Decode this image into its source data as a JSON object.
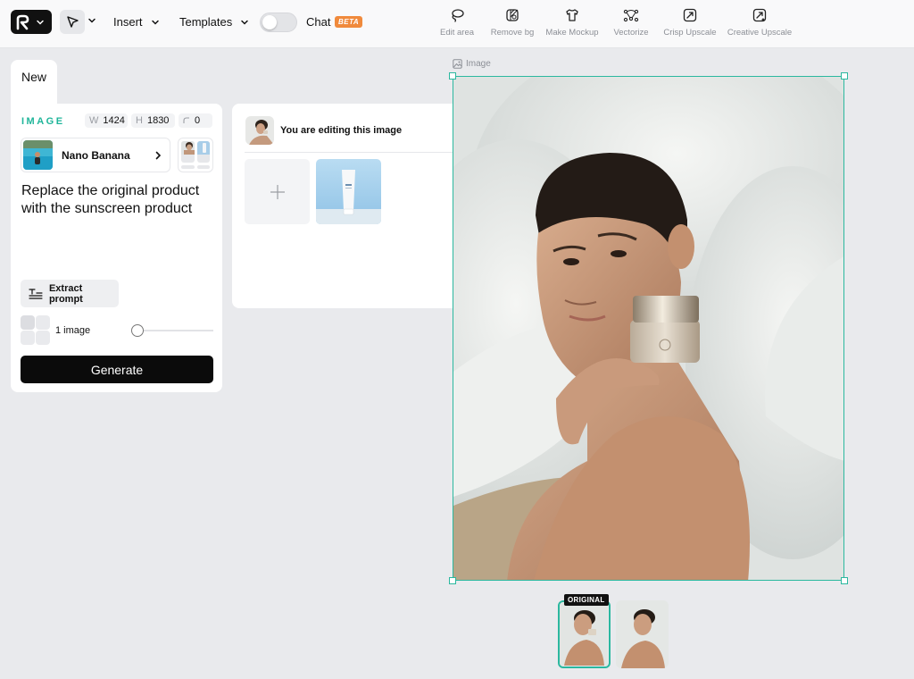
{
  "header": {
    "menus": {
      "insert": "Insert",
      "templates": "Templates",
      "chat": "Chat",
      "beta": "BETA"
    },
    "tools": [
      {
        "label": "Edit area",
        "icon": "lasso-icon"
      },
      {
        "label": "Remove bg",
        "icon": "remove-bg-icon"
      },
      {
        "label": "Make Mockup",
        "icon": "tshirt-icon"
      },
      {
        "label": "Vectorize",
        "icon": "vector-nodes-icon"
      },
      {
        "label": "Crisp Upscale",
        "icon": "upscale-icon"
      },
      {
        "label": "Creative Upscale",
        "icon": "creative-upscale-icon"
      }
    ]
  },
  "panel": {
    "tab": "New",
    "section_label": "IMAGE",
    "width_key": "W",
    "width": "1424",
    "height_key": "H",
    "height": "1830",
    "radius": "0",
    "model": "Nano Banana",
    "prompt": "Replace the original product with the sunscreen product",
    "extract_label": "Extract prompt",
    "image_count": "1 image",
    "generate_label": "Generate"
  },
  "editing": {
    "title": "You are editing this image"
  },
  "canvas": {
    "image_label": "Image"
  },
  "versions": {
    "original_badge": "ORIGINAL",
    "selected_index": 0,
    "count": 2
  },
  "colors": {
    "accent": "#2bb89f",
    "beta": "#f08a3c",
    "generate_bg": "#0b0b0b"
  }
}
